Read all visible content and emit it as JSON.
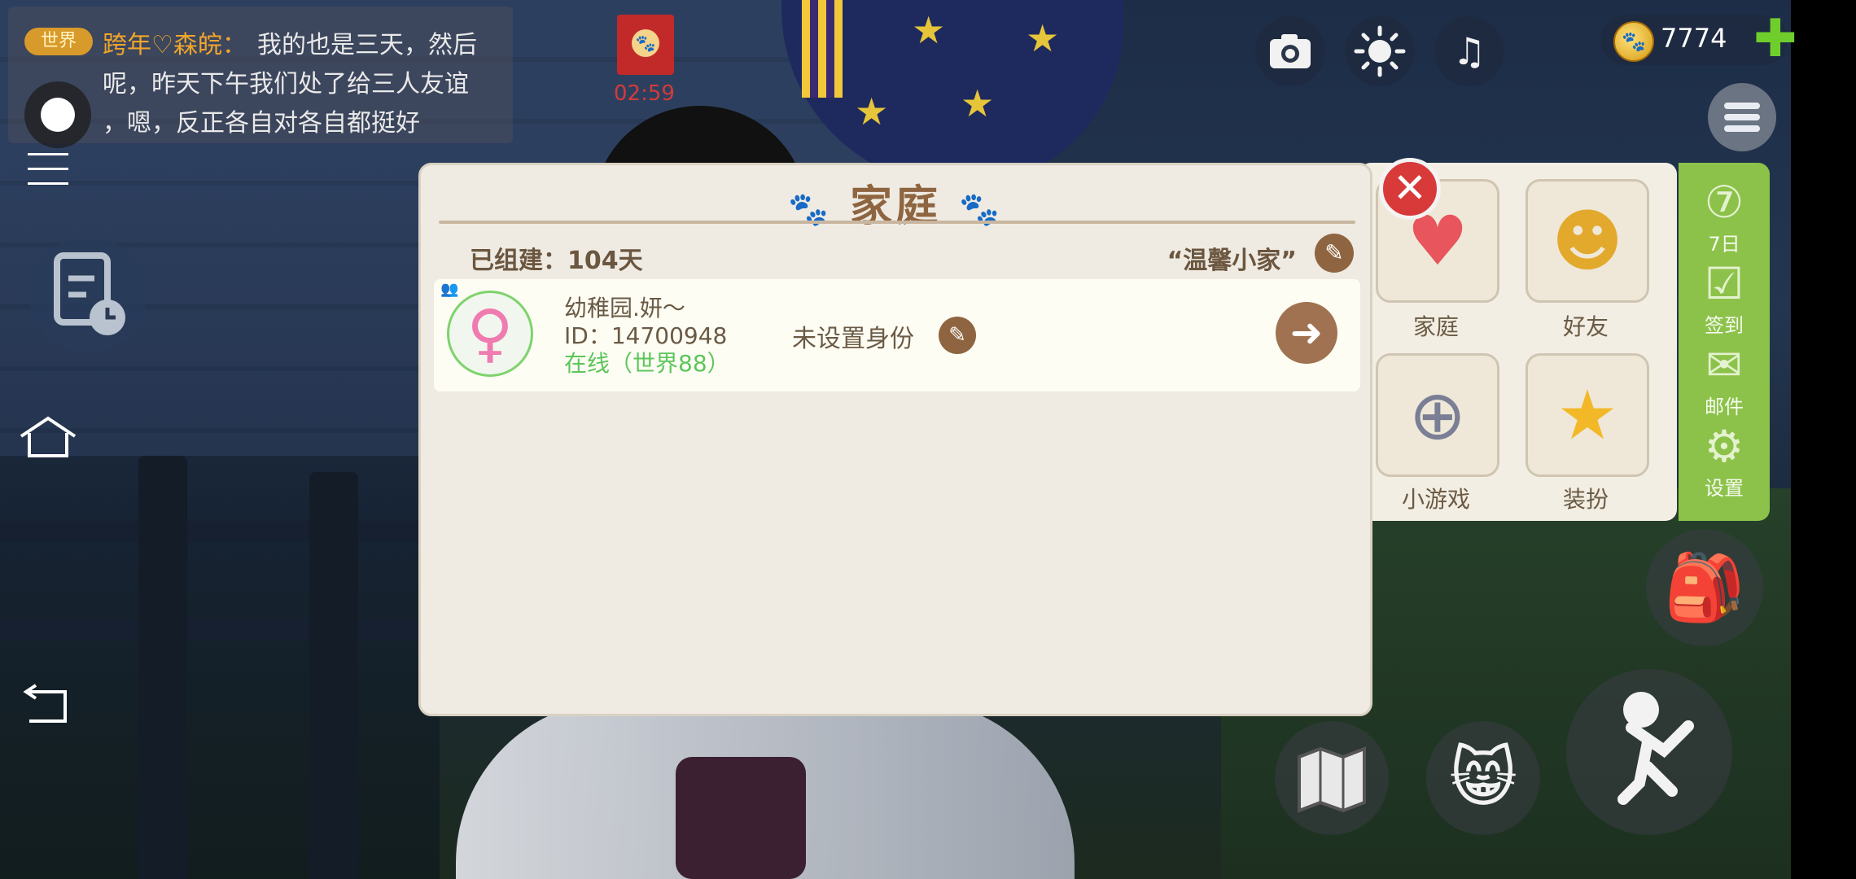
{
  "chat": {
    "channel_badge": "世界",
    "sender": "跨年♡森皖：",
    "line1": "我的也是三天，然后",
    "line2": "呢，昨天下午我们处了给三人友谊",
    "line3": "，嗯，反正各自对各自都挺好"
  },
  "red_envelope": {
    "icon": "paw-icon",
    "timer": "02:59"
  },
  "top_tools": [
    "camera-icon",
    "brightness-icon",
    "music-icon"
  ],
  "currency": {
    "amount": "7774",
    "add_label": "✚"
  },
  "side_menu": {
    "tiles": [
      {
        "label": "家庭",
        "icon": "heart-icon"
      },
      {
        "label": "好友",
        "icon": "friends-icon"
      },
      {
        "label": "小游戏",
        "icon": "gamepad-icon"
      },
      {
        "label": "装扮",
        "icon": "magic-wand-icon"
      }
    ],
    "tabs": [
      {
        "label": "7日",
        "icon": "seven-day-icon"
      },
      {
        "label": "签到",
        "icon": "checkin-icon"
      },
      {
        "label": "邮件",
        "icon": "mail-icon"
      },
      {
        "label": "设置",
        "icon": "gear-icon"
      }
    ]
  },
  "dialog": {
    "title": "家庭",
    "established": "已组建：104天",
    "family_name": "“温馨小家”",
    "member": {
      "name": "幼稚园.妍～",
      "id": "ID：14700948",
      "status": "在线（世界88）",
      "role": "未设置身份"
    },
    "colors": {
      "accent": "#8e6540",
      "online": "#5cc65a",
      "close": "#d83a3a"
    }
  }
}
